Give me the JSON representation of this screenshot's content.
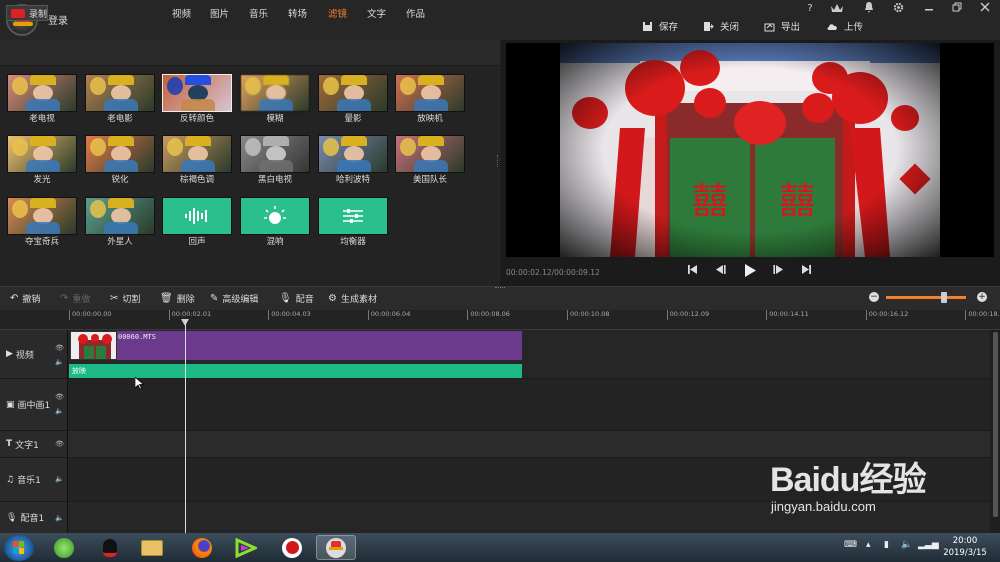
{
  "titlebar": {
    "login": "登录",
    "window_controls": [
      "?",
      "VIP",
      "bell-icon",
      "gear-icon",
      "minimize-icon",
      "restore-icon",
      "close-icon"
    ],
    "actions": {
      "save": "保存",
      "close": "关闭",
      "export": "导出",
      "upload": "上传"
    }
  },
  "tabs": {
    "record": "录制",
    "items": [
      "视频",
      "图片",
      "音乐",
      "转场",
      "滤镜",
      "文字",
      "作品"
    ],
    "active": "滤镜"
  },
  "filters": [
    {
      "label": "老电视",
      "tint": "#d98a7a"
    },
    {
      "label": "老电影",
      "tint": "#b08050"
    },
    {
      "label": "反转颜色",
      "tint": "#3aa0c8"
    },
    {
      "label": "模糊",
      "tint": "#e0a060"
    },
    {
      "label": "暈影",
      "tint": "#a06a3a"
    },
    {
      "label": "放映机",
      "tint": "#d07050"
    },
    {
      "label": "发光",
      "tint": "#f0c070"
    },
    {
      "label": "锐化",
      "tint": "#e07a4a"
    },
    {
      "label": "棕褐色调",
      "tint": "#c89a60"
    },
    {
      "label": "黑白电视",
      "tint": "#888888"
    },
    {
      "label": "哈利波特",
      "tint": "#7a8ab0"
    },
    {
      "label": "美国队长",
      "tint": "#c8707a"
    },
    {
      "label": "夺宝奇兵",
      "tint": "#d88a50"
    },
    {
      "label": "外星人",
      "tint": "#5aa090"
    },
    {
      "label": "回声",
      "tint": "#2bbf8e"
    },
    {
      "label": "混响",
      "tint": "#2bbf8e"
    },
    {
      "label": "均衡器",
      "tint": "#2bbf8e"
    }
  ],
  "player": {
    "timecode": "00:00:02.12/00:00:09.12",
    "controls": [
      "skip-start-icon",
      "step-back-icon",
      "play-icon",
      "step-forward-icon",
      "skip-end-icon"
    ]
  },
  "toolbar": {
    "undo": "撤销",
    "redo": "重做",
    "cut": "切割",
    "delete": "删除",
    "advanced": "高级编辑",
    "dub": "配音",
    "generate": "生成素材",
    "zoom_level": 0.72
  },
  "ruler": [
    "00:00:00.00",
    "00:00:02.01",
    "00:00:04.03",
    "00:00:06.04",
    "00:00:08.06",
    "00:00:10.08",
    "00:00:12.09",
    "00:00:14.11",
    "00:00:16.12",
    "00:00:18."
  ],
  "tracks": {
    "video": "视频",
    "pip": "画中画1",
    "text": "文字1",
    "music": "音乐1",
    "voice": "配音1"
  },
  "clip": {
    "name": "00060.MTS",
    "filter_label": "放映"
  },
  "taskbar": {
    "time": "20:00",
    "date": "2019/3/15"
  },
  "watermark": {
    "brand": "Baidu经验",
    "url": "jingyan.baidu.com"
  }
}
